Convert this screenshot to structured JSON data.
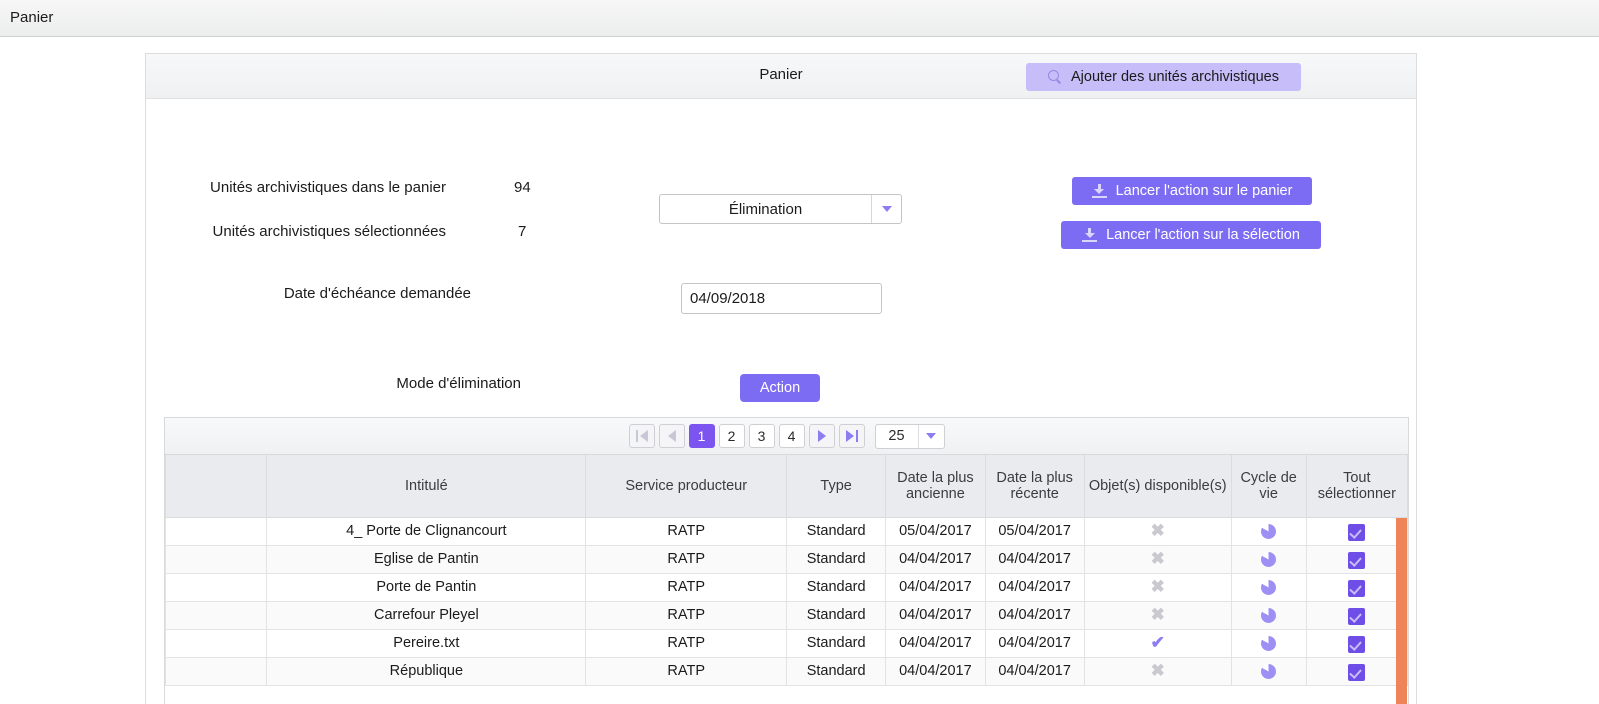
{
  "window": {
    "tab_title": "Panier"
  },
  "panel": {
    "title": "Panier",
    "add_units_button": {
      "label": "Ajouter des unités archivistiques",
      "icon": "search-icon"
    }
  },
  "form": {
    "basket_count_label": "Unités archivistiques dans le panier",
    "basket_count_value": "94",
    "selected_count_label": "Unités archivistiques sélectionnées",
    "selected_count_value": "7",
    "action_select_value": "Élimination",
    "due_date_label": "Date d'échéance demandée",
    "due_date_value": "04/09/2018",
    "elimination_mode_label": "Mode d'élimination",
    "action_button_label": "Action",
    "launch_basket_label": "Lancer l'action sur le panier",
    "launch_selection_label": "Lancer l'action sur la sélection"
  },
  "pagination": {
    "first_label": "first-page",
    "prev_label": "previous-page",
    "pages": [
      "1",
      "2",
      "3",
      "4"
    ],
    "active_page": "1",
    "next_label": "next-page",
    "last_label": "last-page",
    "page_size": "25"
  },
  "table": {
    "headers": [
      "",
      "Intitulé",
      "Service producteur",
      "Type",
      "Date la plus ancienne",
      "Date la plus récente",
      "Objet(s) disponible(s)",
      "Cycle de vie",
      "Tout sélectionner"
    ],
    "rows": [
      {
        "title": "4_ Porte de Clignancourt",
        "service": "RATP",
        "type": "Standard",
        "oldest": "05/04/2017",
        "newest": "05/04/2017",
        "object_available": false,
        "lifecycle": "pie-chart-icon",
        "selected": true
      },
      {
        "title": "Eglise de Pantin",
        "service": "RATP",
        "type": "Standard",
        "oldest": "04/04/2017",
        "newest": "04/04/2017",
        "object_available": false,
        "lifecycle": "pie-chart-icon",
        "selected": true
      },
      {
        "title": "Porte de Pantin",
        "service": "RATP",
        "type": "Standard",
        "oldest": "04/04/2017",
        "newest": "04/04/2017",
        "object_available": false,
        "lifecycle": "pie-chart-icon",
        "selected": true
      },
      {
        "title": "Carrefour Pleyel",
        "service": "RATP",
        "type": "Standard",
        "oldest": "04/04/2017",
        "newest": "04/04/2017",
        "object_available": false,
        "lifecycle": "pie-chart-icon",
        "selected": true
      },
      {
        "title": "Pereire.txt",
        "service": "RATP",
        "type": "Standard",
        "oldest": "04/04/2017",
        "newest": "04/04/2017",
        "object_available": true,
        "lifecycle": "pie-chart-icon",
        "selected": true
      },
      {
        "title": "République",
        "service": "RATP",
        "type": "Standard",
        "oldest": "04/04/2017",
        "newest": "04/04/2017",
        "object_available": false,
        "lifecycle": "pie-chart-icon",
        "selected": true
      }
    ],
    "marks": {
      "available": "✔",
      "unavailable": "✖"
    }
  },
  "colors": {
    "accent_purple": "#7c6cf3",
    "active_page_purple": "#7c54f0",
    "light_purple_button": "#c7bdf8",
    "checkbox_purple": "#6f4ee8",
    "scrollbar_orange": "#ee8457",
    "header_grey": "#eaebee"
  }
}
